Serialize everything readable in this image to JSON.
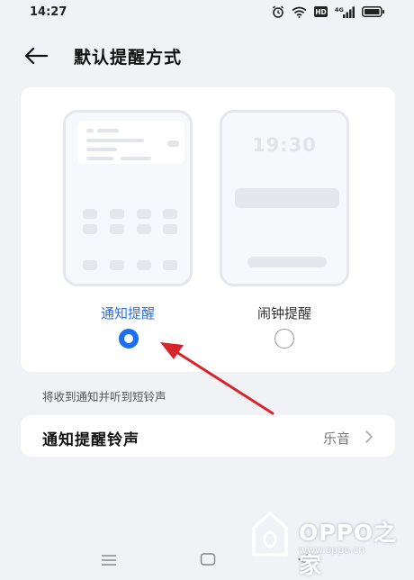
{
  "status_bar": {
    "time": "14:27",
    "hd_label": "HD",
    "network_label": "4G"
  },
  "header": {
    "title": "默认提醒方式"
  },
  "preview": {
    "lock_time": "19:30"
  },
  "options": [
    {
      "label": "通知提醒",
      "selected": true
    },
    {
      "label": "闹钟提醒",
      "selected": false
    }
  ],
  "description": "将收到通知并听到短铃声",
  "ringtone_row": {
    "label": "通知提醒铃声",
    "value": "乐音"
  },
  "watermark": {
    "text": "OPPO之家",
    "url": "www.oppo.cn"
  },
  "colors": {
    "accent": "#1b6ff0",
    "annotation_arrow": "#d9242c"
  }
}
